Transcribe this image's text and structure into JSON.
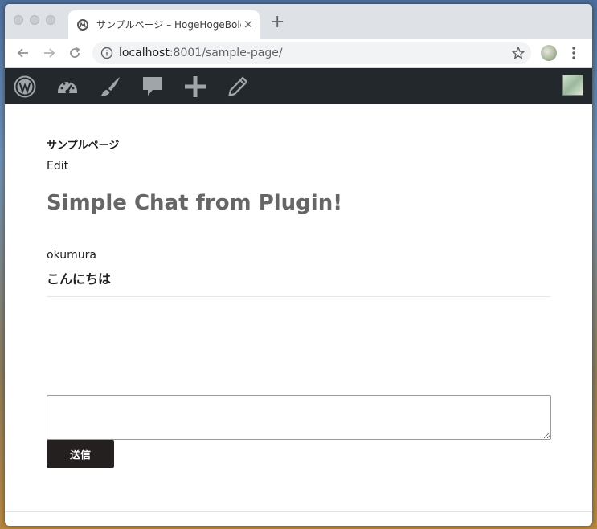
{
  "browser": {
    "tab_title": "サンプルページ – HogeHogeBolg",
    "tab_close": "×",
    "new_tab": "+",
    "url_host": "localhost",
    "url_rest": ":8001/sample-page/",
    "icons": {
      "back": "back-arrow-icon",
      "forward": "forward-arrow-icon",
      "reload": "reload-icon",
      "info": "info-icon",
      "star": "star-icon",
      "menu": "menu-dots-icon"
    }
  },
  "adminbar": {
    "background": "#23282d",
    "icons": [
      "wordpress-logo-icon",
      "dashboard-gauge-icon",
      "customize-brush-icon",
      "comments-icon",
      "new-plus-icon",
      "edit-pencil-icon"
    ]
  },
  "page": {
    "heading": "サンプルページ",
    "edit_link": "Edit",
    "chat_title": "Simple Chat from Plugin!",
    "messages": [
      {
        "user": "okumura",
        "text": "こんにちは"
      }
    ],
    "input_value": "",
    "send_label": "送信"
  }
}
